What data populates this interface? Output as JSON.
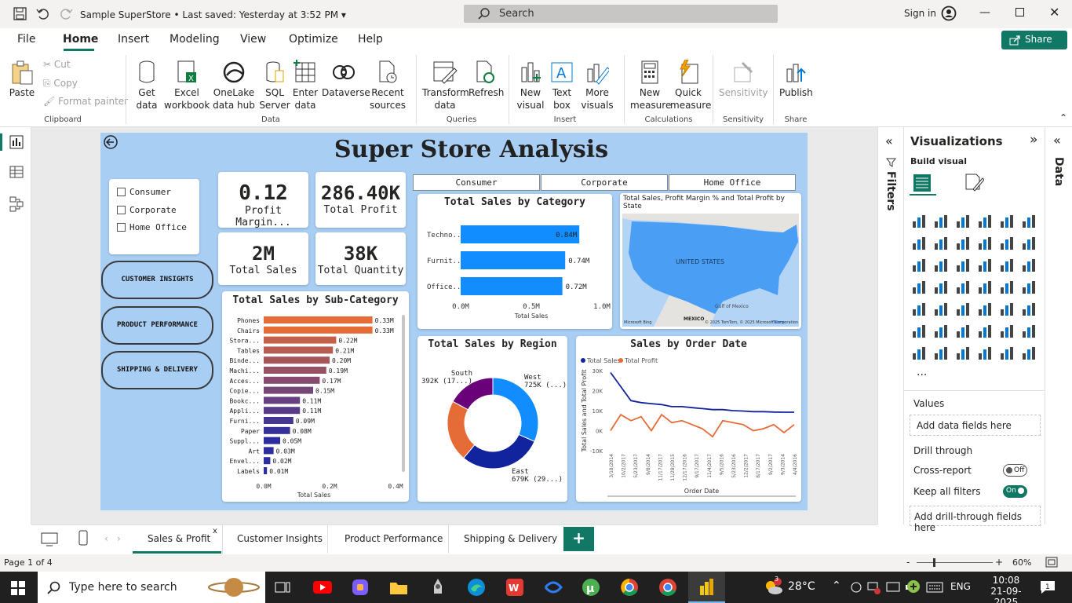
{
  "titlebar": {
    "doc_title": "Sample SuperStore",
    "saved": "Last saved: Yesterday at 3:52 PM",
    "search_placeholder": "Search",
    "sign_in": "Sign in"
  },
  "ribbon_tabs": [
    "File",
    "Home",
    "Insert",
    "Modeling",
    "View",
    "Optimize",
    "Help"
  ],
  "share_label": "Share",
  "ribbon": {
    "clipboard": {
      "paste": "Paste",
      "cut": "Cut",
      "copy": "Copy",
      "format_painter": "Format painter",
      "group": "Clipboard"
    },
    "data": {
      "get_data": "Get data",
      "excel": "Excel workbook",
      "onelake": "OneLake data hub",
      "sql": "SQL Server",
      "enter": "Enter data",
      "dataverse": "Dataverse",
      "recent": "Recent sources",
      "group": "Data"
    },
    "queries": {
      "transform": "Transform data",
      "refresh": "Refresh",
      "group": "Queries"
    },
    "insert": {
      "new_visual": "New visual",
      "text_box": "Text box",
      "more_visuals": "More visuals",
      "group": "Insert"
    },
    "calculations": {
      "new_measure": "New measure",
      "quick_measure": "Quick measure",
      "group": "Calculations"
    },
    "sensitivity": {
      "label": "Sensitivity",
      "group": "Sensitivity"
    },
    "share": {
      "publish": "Publish",
      "group": "Share"
    }
  },
  "report": {
    "title": "Super Store Analysis",
    "segments": [
      "Consumer",
      "Corporate",
      "Home Office"
    ],
    "checkbox_segments": [
      "Consumer",
      "Corporate",
      "Home Office"
    ],
    "nav_buttons": [
      "CUSTOMER INSIGHTS",
      "PRODUCT PERFORMANCE",
      "SHIPPING & DELIVERY"
    ],
    "kpis": [
      {
        "value": "0.12",
        "label": "Profit Margin..."
      },
      {
        "value": "286.40K",
        "label": "Total Profit"
      },
      {
        "value": "2M",
        "label": "Total Sales"
      },
      {
        "value": "38K",
        "label": "Total Quantity"
      }
    ],
    "map": {
      "title": "Total Sales, Profit Margin % and Total Profit by State",
      "country": "UNITED STATES",
      "gulf": "Gulf of Mexico",
      "mexico": "MEXICO",
      "attribution": "© 2025 TomTom, © 2025 Microsoft Corporation",
      "terms": "Terms",
      "bing": "Microsoft Bing"
    }
  },
  "chart_data": [
    {
      "type": "bar",
      "title": "Total Sales by Category",
      "categories": [
        "Techno...",
        "Furnit...",
        "Office..."
      ],
      "values": [
        0.84,
        0.74,
        0.72
      ],
      "value_labels": [
        "0.84M",
        "0.74M",
        "0.72M"
      ],
      "xticks": [
        "0.0M",
        "0.5M",
        "1.0M"
      ],
      "xlabel": "Total Sales",
      "xlim": [
        0,
        1.0
      ],
      "color": "#118dff"
    },
    {
      "type": "bar",
      "title": "Total Sales by Sub-Category",
      "categories": [
        "Phones",
        "Chairs",
        "Stora...",
        "Tables",
        "Binde...",
        "Machi...",
        "Acces...",
        "Copie...",
        "Bookc...",
        "Appli...",
        "Furni...",
        "Paper",
        "Suppl...",
        "Art",
        "Envel...",
        "Labels"
      ],
      "values": [
        0.33,
        0.33,
        0.22,
        0.21,
        0.2,
        0.19,
        0.17,
        0.15,
        0.11,
        0.11,
        0.09,
        0.08,
        0.05,
        0.03,
        0.02,
        0.01
      ],
      "value_labels": [
        "0.33M",
        "0.33M",
        "0.22M",
        "0.21M",
        "0.20M",
        "0.19M",
        "0.17M",
        "0.15M",
        "0.11M",
        "0.11M",
        "0.09M",
        "0.08M",
        "0.05M",
        "0.03M",
        "0.02M",
        "0.01M"
      ],
      "xticks": [
        "0.0M",
        "0.2M",
        "0.4M"
      ],
      "xlabel": "Total Sales",
      "xlim": [
        0,
        0.4
      ]
    },
    {
      "type": "pie",
      "title": "Total Sales by Region",
      "slices": [
        {
          "label": "West",
          "value": 725,
          "text": "West",
          "text2": "725K (...)",
          "color": "#118dff"
        },
        {
          "label": "East",
          "value": 679,
          "text": "East",
          "text2": "679K (29...)",
          "color": "#12239e"
        },
        {
          "label": "Central",
          "value": 501,
          "text": "",
          "text2": "",
          "color": "#e66c37"
        },
        {
          "label": "South",
          "value": 392,
          "text": "South",
          "text2": "392K (17...)",
          "color": "#6b007b"
        }
      ]
    },
    {
      "type": "line",
      "title": "Sales by Order Date",
      "ylabel": "Total Sales and Total Profit",
      "xlabel": "Order Date",
      "legend": [
        "Total Sales",
        "Total Profit"
      ],
      "yticks": [
        "30K",
        "20K",
        "10K",
        "0K",
        "-10K"
      ],
      "x": [
        "3/18/2014",
        "10/2/2017",
        "5/23/2017",
        "9/8/2014",
        "11/17/2017",
        "11/28/2015",
        "12/17/2016",
        "9/17/2017",
        "11/4/2017",
        "9/5/2016",
        "5/23/2016",
        "12/2/2017",
        "8/17/2017",
        "9/2/2017",
        "9/3/2014",
        "4/4/2016"
      ],
      "series": [
        {
          "name": "Total Sales",
          "color": "#12239e",
          "values": [
            29,
            22,
            15,
            14,
            13.5,
            13,
            12,
            12,
            11.5,
            11,
            10.5,
            10.5,
            10,
            9.8,
            9.5,
            9.5,
            9.3,
            9.2,
            9.2
          ]
        },
        {
          "name": "Total Profit",
          "color": "#e66c37",
          "values": [
            0,
            8,
            5,
            7,
            0,
            8,
            4,
            5,
            3,
            1,
            -3,
            5,
            4,
            3,
            0,
            1,
            3,
            -1,
            3
          ]
        }
      ]
    }
  ],
  "filters_label": "Filters",
  "viz_pane": {
    "title": "Visualizations",
    "build_visual": "Build visual",
    "values": "Values",
    "add_data_fields": "Add data fields here",
    "drill_through": "Drill through",
    "cross_report": "Cross-report",
    "cross_report_state": "Off",
    "keep_all_filters": "Keep all filters",
    "keep_state": "On",
    "add_drill": "Add drill-through fields here",
    "more": "..."
  },
  "data_label": "Data",
  "pages": [
    "Sales & Profit",
    "Customer Insights",
    "Product Performance",
    "Shipping & Delivery"
  ],
  "active_page": "Sales & Profit",
  "status": {
    "page": "Page 1 of 4",
    "zoom": "60%"
  },
  "taskbar": {
    "search_placeholder": "Type here to search",
    "weather": "28°C",
    "lang": "ENG",
    "time": "10:08",
    "date": "21-09-2025",
    "notif": "3"
  }
}
